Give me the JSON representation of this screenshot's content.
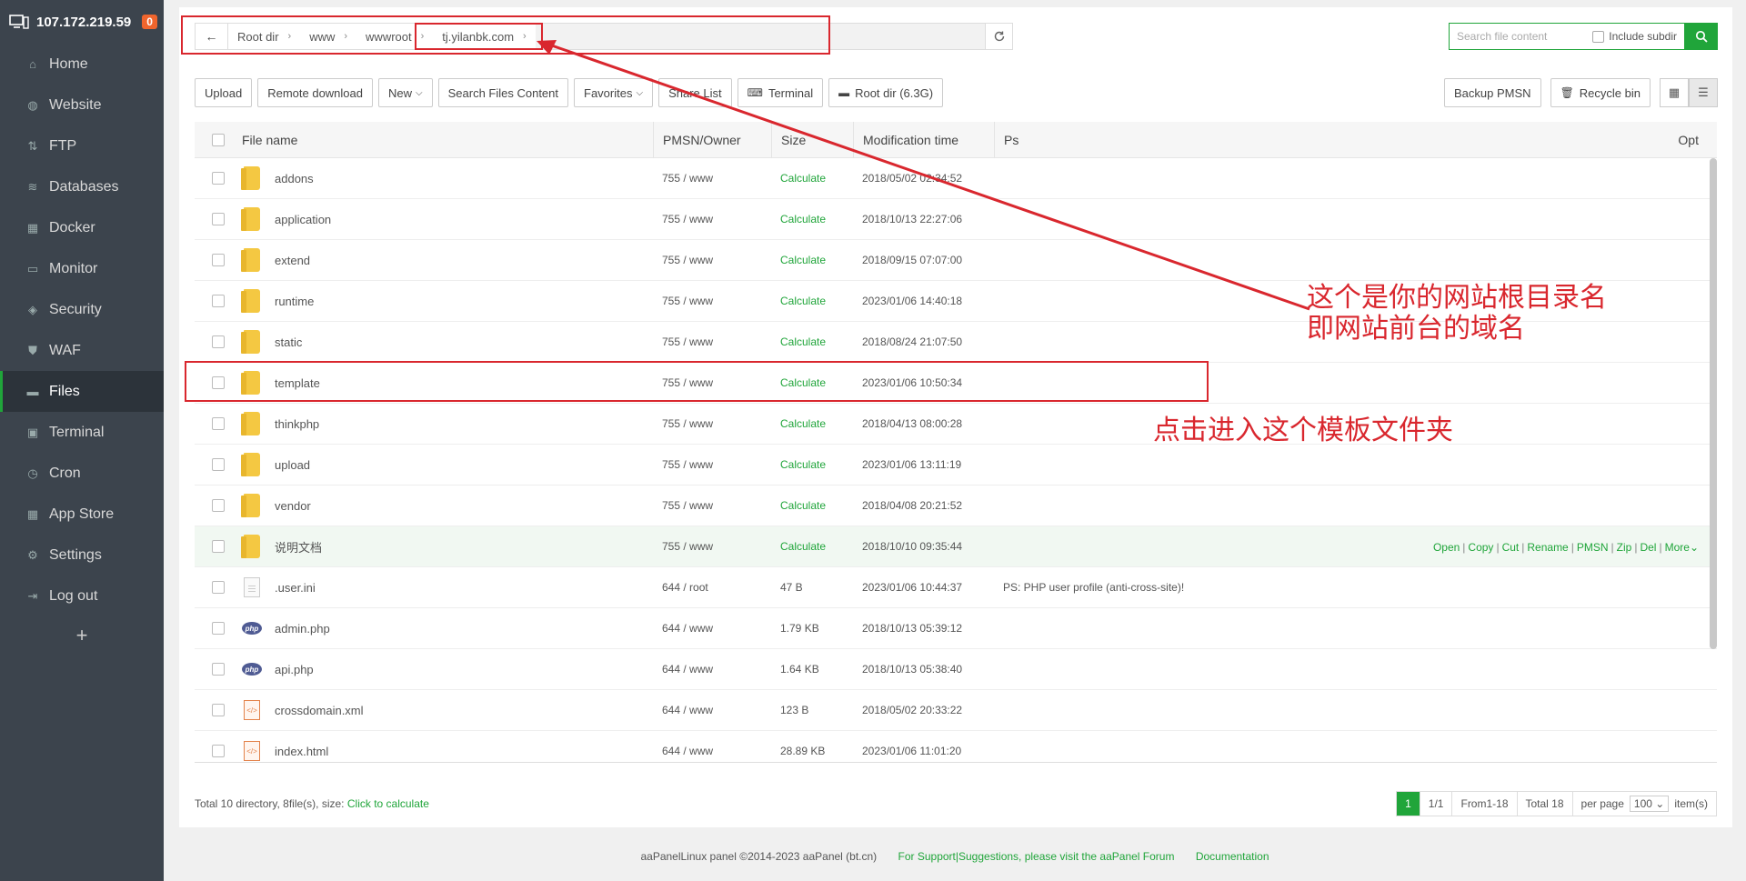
{
  "sidebar": {
    "ip": "107.172.219.59",
    "badge": "0",
    "items": [
      {
        "label": "Home",
        "icon": "home-icon"
      },
      {
        "label": "Website",
        "icon": "globe-icon"
      },
      {
        "label": "FTP",
        "icon": "ftp-icon"
      },
      {
        "label": "Databases",
        "icon": "database-icon"
      },
      {
        "label": "Docker",
        "icon": "docker-icon"
      },
      {
        "label": "Monitor",
        "icon": "monitor-icon"
      },
      {
        "label": "Security",
        "icon": "shield-icon"
      },
      {
        "label": "WAF",
        "icon": "waf-icon"
      },
      {
        "label": "Files",
        "icon": "folder-icon"
      },
      {
        "label": "Terminal",
        "icon": "terminal-icon"
      },
      {
        "label": "Cron",
        "icon": "clock-icon"
      },
      {
        "label": "App Store",
        "icon": "grid-icon"
      },
      {
        "label": "Settings",
        "icon": "gear-icon"
      },
      {
        "label": "Log out",
        "icon": "logout-icon"
      }
    ],
    "plus": "+"
  },
  "breadcrumb": [
    "Root dir",
    "www",
    "wwwroot",
    "tj.yilanbk.com"
  ],
  "search": {
    "placeholder": "Search file content",
    "include_subdir": "Include subdir"
  },
  "toolbar": {
    "upload": "Upload",
    "remote_download": "Remote download",
    "new": "New",
    "search_files": "Search Files Content",
    "favorites": "Favorites",
    "share_list": "Share List",
    "terminal": "Terminal",
    "root_dir": "Root dir (6.3G)",
    "backup": "Backup PMSN",
    "recycle": "Recycle bin"
  },
  "table": {
    "headers": {
      "name": "File name",
      "perm": "PMSN/Owner",
      "size": "Size",
      "mod": "Modification time",
      "ps": "Ps",
      "opt": "Opt"
    },
    "rows": [
      {
        "type": "folder",
        "name": "addons",
        "perm": "755 / www",
        "size": "Calculate",
        "mod": "2018/05/02 02:34:52",
        "ps": ""
      },
      {
        "type": "folder",
        "name": "application",
        "perm": "755 / www",
        "size": "Calculate",
        "mod": "2018/10/13 22:27:06",
        "ps": ""
      },
      {
        "type": "folder",
        "name": "extend",
        "perm": "755 / www",
        "size": "Calculate",
        "mod": "2018/09/15 07:07:00",
        "ps": ""
      },
      {
        "type": "folder",
        "name": "runtime",
        "perm": "755 / www",
        "size": "Calculate",
        "mod": "2023/01/06 14:40:18",
        "ps": ""
      },
      {
        "type": "folder",
        "name": "static",
        "perm": "755 / www",
        "size": "Calculate",
        "mod": "2018/08/24 21:07:50",
        "ps": ""
      },
      {
        "type": "folder",
        "name": "template",
        "perm": "755 / www",
        "size": "Calculate",
        "mod": "2023/01/06 10:50:34",
        "ps": ""
      },
      {
        "type": "folder",
        "name": "thinkphp",
        "perm": "755 / www",
        "size": "Calculate",
        "mod": "2018/04/13 08:00:28",
        "ps": ""
      },
      {
        "type": "folder",
        "name": "upload",
        "perm": "755 / www",
        "size": "Calculate",
        "mod": "2023/01/06 13:11:19",
        "ps": ""
      },
      {
        "type": "folder",
        "name": "vendor",
        "perm": "755 / www",
        "size": "Calculate",
        "mod": "2018/04/08 20:21:52",
        "ps": ""
      },
      {
        "type": "folder",
        "name": "说明文档",
        "perm": "755 / www",
        "size": "Calculate",
        "mod": "2018/10/10 09:35:44",
        "ps": "",
        "hover": true
      },
      {
        "type": "file",
        "name": ".user.ini",
        "perm": "644 / root",
        "size": "47 B",
        "mod": "2023/01/06 10:44:37",
        "ps": "PS: PHP user profile (anti-cross-site)!"
      },
      {
        "type": "php",
        "name": "admin.php",
        "perm": "644 / www",
        "size": "1.79 KB",
        "mod": "2018/10/13 05:39:12",
        "ps": ""
      },
      {
        "type": "php",
        "name": "api.php",
        "perm": "644 / www",
        "size": "1.64 KB",
        "mod": "2018/10/13 05:38:40",
        "ps": ""
      },
      {
        "type": "xml",
        "name": "crossdomain.xml",
        "perm": "644 / www",
        "size": "123 B",
        "mod": "2018/05/02 20:33:22",
        "ps": ""
      },
      {
        "type": "html",
        "name": "index.html",
        "perm": "644 / www",
        "size": "28.89 KB",
        "mod": "2023/01/06 11:01:20",
        "ps": ""
      }
    ],
    "ops": [
      "Open",
      "Copy",
      "Cut",
      "Rename",
      "PMSN",
      "Zip",
      "Del",
      "More"
    ]
  },
  "footer": {
    "summary": "Total 10 directory, 8file(s), size:",
    "calc_link": "Click to calculate",
    "page": "1",
    "pages": "1/1",
    "range": "From1-18",
    "total": "Total 18",
    "per_page": "per page",
    "per_value": "100",
    "items": "item(s)"
  },
  "page_footer": {
    "copyright": "aaPanelLinux panel ©2014-2023 aaPanel (bt.cn)",
    "support": "For Support|Suggestions, please visit the aaPanel Forum",
    "docs": "Documentation"
  },
  "annotations": {
    "domain_note_1": "这个是你的网站根目录名",
    "domain_note_2": "即网站前台的域名",
    "template_note": "点击进入这个模板文件夹"
  },
  "colors": {
    "accent": "#20a53a",
    "annotation": "#d9272e",
    "sidebar": "#3c444d"
  }
}
